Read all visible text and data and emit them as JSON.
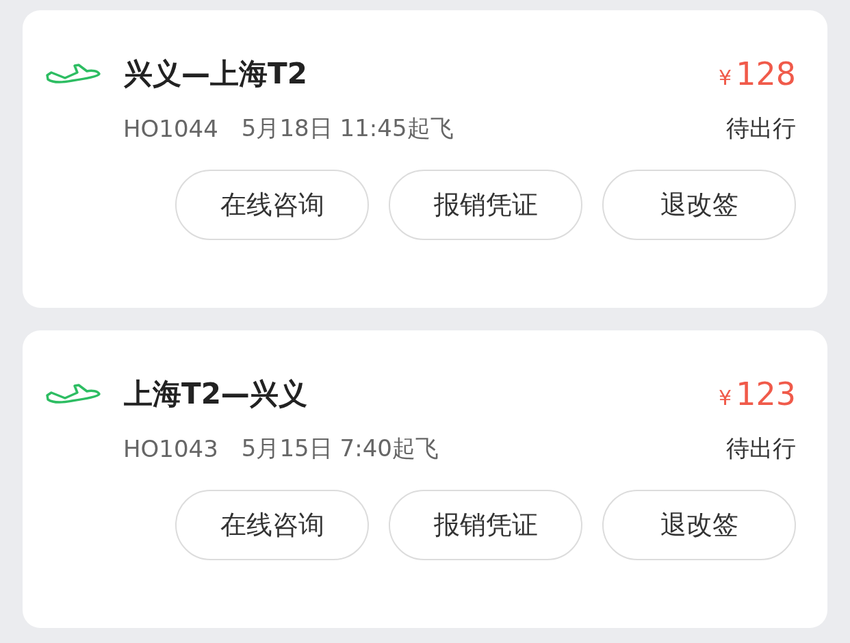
{
  "trips": [
    {
      "route": "兴义—上海T2",
      "currency": "¥",
      "price": "128",
      "flight_no": "HO1044",
      "departure": "5月18日 11:45起飞",
      "status": "待出行",
      "actions": [
        "在线咨询",
        "报销凭证",
        "退改签"
      ]
    },
    {
      "route": "上海T2—兴义",
      "currency": "¥",
      "price": "123",
      "flight_no": "HO1043",
      "departure": "5月15日 7:40起飞",
      "status": "待出行",
      "actions": [
        "在线咨询",
        "报销凭证",
        "退改签"
      ]
    }
  ]
}
